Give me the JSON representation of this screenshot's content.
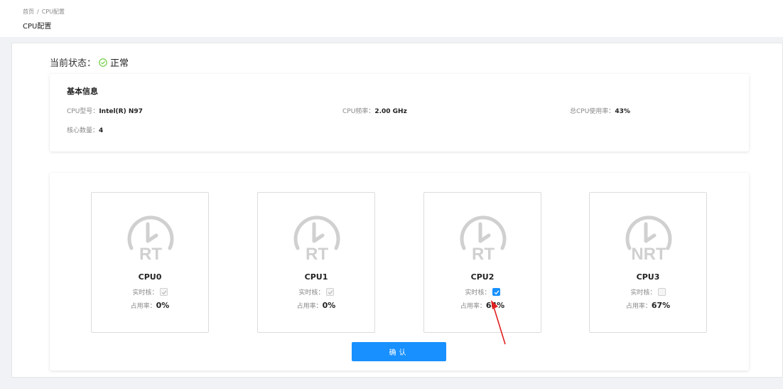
{
  "breadcrumb": {
    "home": "首页",
    "separator": "/",
    "current": "CPU配置"
  },
  "page_title": "CPU配置",
  "status": {
    "label": "当前状态：",
    "value": "正常",
    "icon": "check-circle-icon",
    "color": "#52c41a"
  },
  "basic_info": {
    "title": "基本信息",
    "model_label": "CPU型号：",
    "model_value": "Intel(R) N97",
    "freq_label": "CPU频率：",
    "freq_value": "2.00 GHz",
    "usage_label": "总CPU使用率：",
    "usage_value": "43%",
    "cores_label": "核心数量：",
    "cores_value": "4"
  },
  "cores": [
    {
      "name": "CPU0",
      "tag": "RT",
      "rt_label": "实时核：",
      "rt_state": "checked-disabled",
      "usage_label": "占用率：",
      "usage": "0%"
    },
    {
      "name": "CPU1",
      "tag": "RT",
      "rt_label": "实时核：",
      "rt_state": "checked-disabled",
      "usage_label": "占用率：",
      "usage": "0%"
    },
    {
      "name": "CPU2",
      "tag": "RT",
      "rt_label": "实时核：",
      "rt_state": "checked",
      "usage_label": "占用率：",
      "usage": "64%"
    },
    {
      "name": "CPU3",
      "tag": "NRT",
      "rt_label": "实时核：",
      "rt_state": "unchecked",
      "usage_label": "占用率：",
      "usage": "67%"
    }
  ],
  "confirm_label": "确认",
  "colors": {
    "primary": "#1890ff",
    "annotation": "#e02020",
    "icon_gray": "#d0d0d0"
  }
}
